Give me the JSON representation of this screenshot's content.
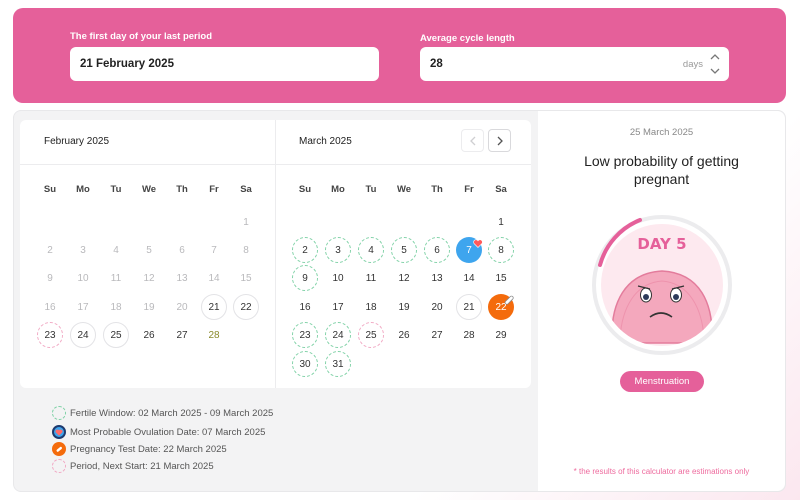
{
  "form": {
    "last_period_label": "The first day of your last period",
    "last_period_value": "21 February 2025",
    "cycle_label": "Average cycle length",
    "cycle_value": "28",
    "cycle_unit": "days"
  },
  "calendar": {
    "weekdays": [
      "Su",
      "Mo",
      "Tu",
      "We",
      "Th",
      "Fr",
      "Sa"
    ],
    "february": {
      "title": "February 2025",
      "rows": [
        [
          "",
          "",
          "",
          "",
          "",
          "",
          "1"
        ],
        [
          "2",
          "3",
          "4",
          "5",
          "6",
          "7",
          "8"
        ],
        [
          "9",
          "10",
          "11",
          "12",
          "13",
          "14",
          "15"
        ],
        [
          "16",
          "17",
          "18",
          "19",
          "20",
          "21",
          "22"
        ],
        [
          "23",
          "24",
          "25",
          "26",
          "27",
          "28",
          ""
        ]
      ]
    },
    "march": {
      "title": "March 2025",
      "rows": [
        [
          "",
          "",
          "",
          "",
          "",
          "",
          "1"
        ],
        [
          "2",
          "3",
          "4",
          "5",
          "6",
          "7",
          "8"
        ],
        [
          "9",
          "10",
          "11",
          "12",
          "13",
          "14",
          "15"
        ],
        [
          "16",
          "17",
          "18",
          "19",
          "20",
          "21",
          "22"
        ],
        [
          "23",
          "24",
          "25",
          "26",
          "27",
          "28",
          "29"
        ],
        [
          "30",
          "31",
          "",
          "",
          "",
          "",
          ""
        ]
      ]
    }
  },
  "legend": {
    "fertile": "Fertile Window: 02 March 2025 - 09 March 2025",
    "ovulation": "Most Probable Ovulation Date: 07 March 2025",
    "test": "Pregnancy Test Date: 22 March 2025",
    "period": "Period, Next Start: 21 March 2025"
  },
  "result": {
    "date": "25 March 2025",
    "title": "Low probability of getting pregnant",
    "day_label": "DAY 5",
    "phase": "Menstruation",
    "disclaimer": "* the results of this calculator are estimations only"
  },
  "colors": {
    "brand_pink": "#e5609a",
    "fertile_green": "#7fd1a6",
    "ovulation_blue": "#3ea5ee",
    "test_orange": "#f46b0c"
  }
}
